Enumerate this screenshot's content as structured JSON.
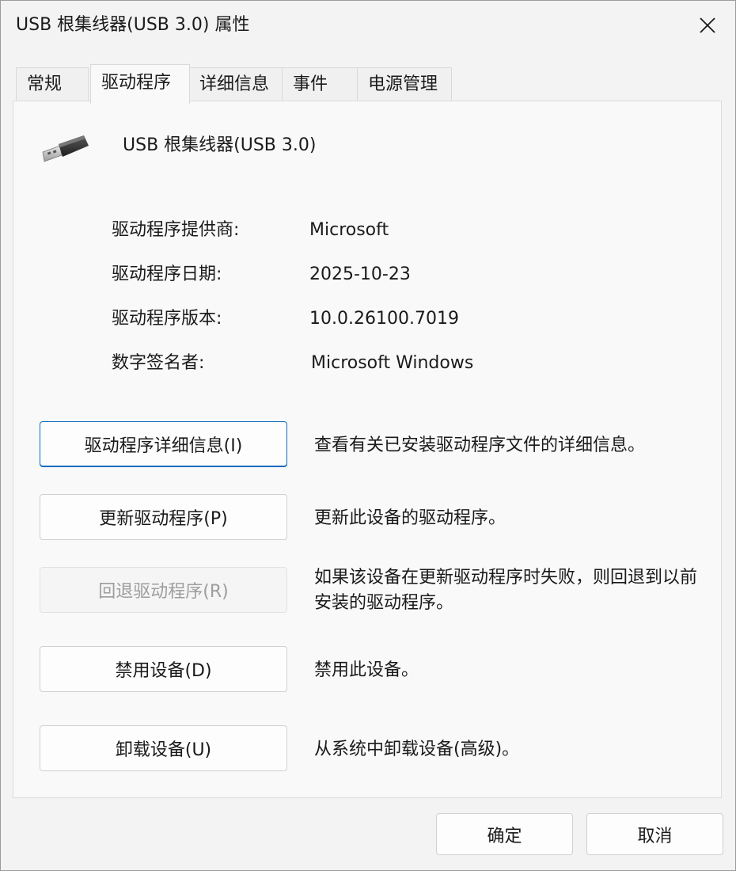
{
  "window": {
    "title": "USB 根集线器(USB 3.0) 属性"
  },
  "tabs": [
    {
      "label": "常规"
    },
    {
      "label": "驱动程序"
    },
    {
      "label": "详细信息"
    },
    {
      "label": "事件"
    },
    {
      "label": "电源管理"
    }
  ],
  "active_tab": "驱动程序",
  "device": {
    "name": "USB 根集线器(USB 3.0)",
    "icon": "usb-plug-icon"
  },
  "driver_info": [
    {
      "label": "驱动程序提供商:",
      "value": "Microsoft"
    },
    {
      "label": "驱动程序日期:",
      "value": "2025-10-23"
    },
    {
      "label": "驱动程序版本:",
      "value": "10.0.26100.7019"
    },
    {
      "label": "数字签名者:",
      "value": "Microsoft Windows"
    }
  ],
  "actions": [
    {
      "label": "驱动程序详细信息(I)",
      "desc": "查看有关已安装驱动程序文件的详细信息。",
      "enabled": true,
      "focused": true
    },
    {
      "label": "更新驱动程序(P)",
      "desc": "更新此设备的驱动程序。",
      "enabled": true
    },
    {
      "label": "回退驱动程序(R)",
      "desc": "如果该设备在更新驱动程序时失败，则回退到以前安装的驱动程序。",
      "enabled": false
    },
    {
      "label": "禁用设备(D)",
      "desc": "禁用此设备。",
      "enabled": true
    },
    {
      "label": "卸载设备(U)",
      "desc": "从系统中卸载设备(高级)。",
      "enabled": true
    }
  ],
  "footer": {
    "ok_label": "确定",
    "cancel_label": "取消"
  },
  "colors": {
    "accent": "#0f6cbd",
    "disabled_text": "#9d9d9d"
  }
}
